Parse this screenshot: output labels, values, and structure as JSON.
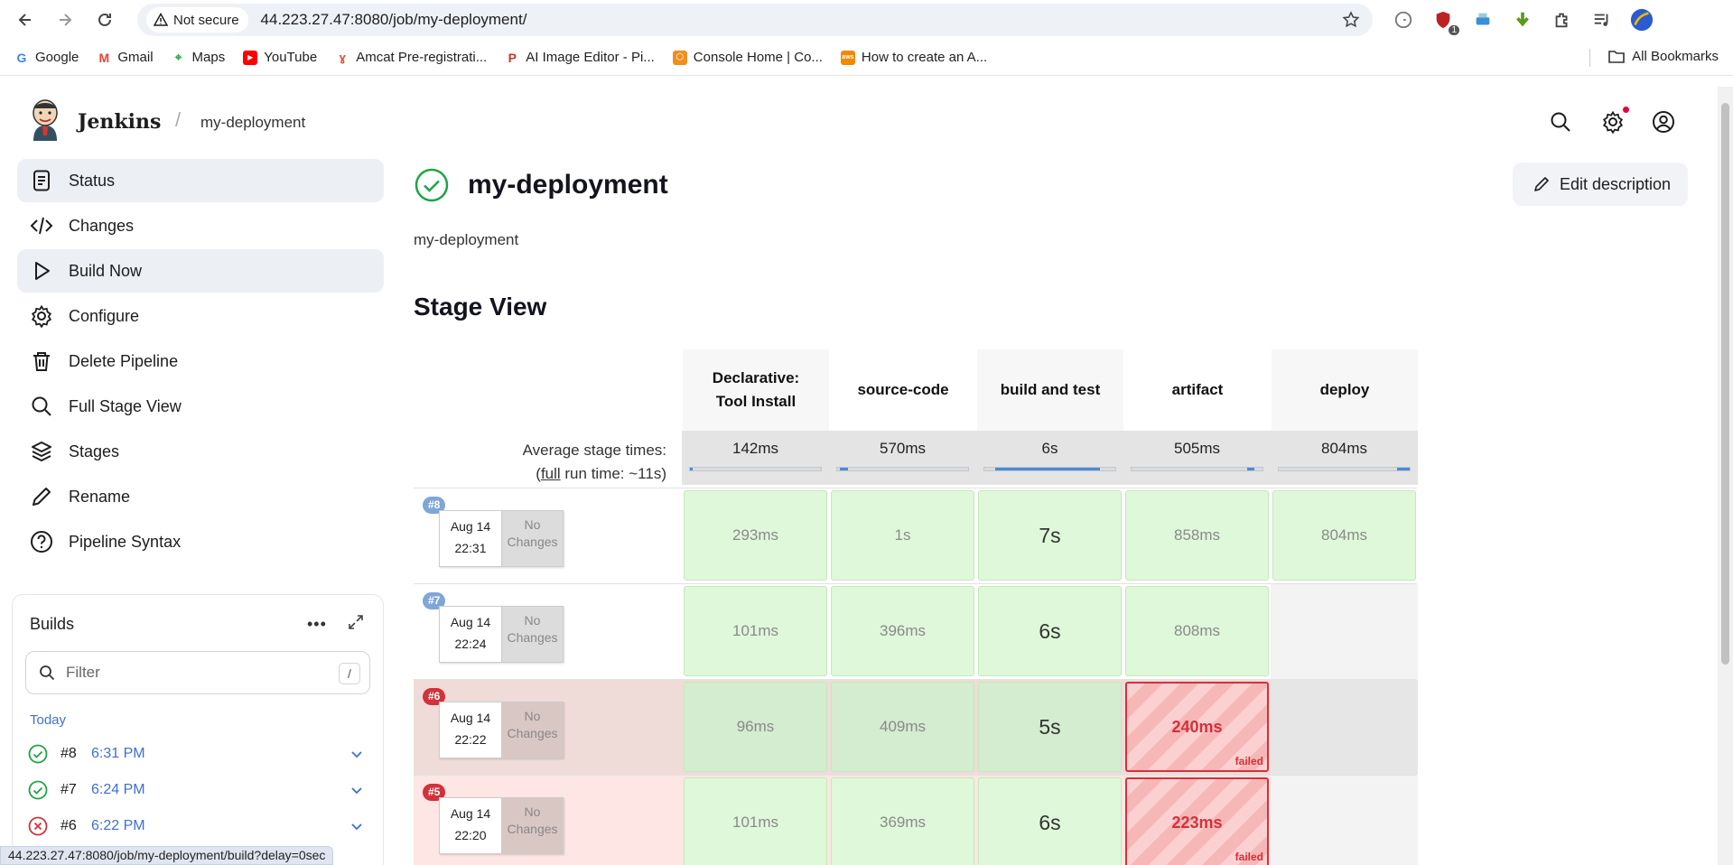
{
  "browser": {
    "security_label": "Not secure",
    "url": "44.223.27.47:8080/job/my-deployment/",
    "bookmarks": [
      {
        "label": "Google",
        "color": "#4285f4",
        "glyph": "G"
      },
      {
        "label": "Gmail",
        "color": "#ea4335",
        "glyph": "M"
      },
      {
        "label": "Maps",
        "color": "#34a853",
        "glyph": "⌖"
      },
      {
        "label": "YouTube",
        "color": "#ff0000",
        "glyph": "▶"
      },
      {
        "label": "Amcat Pre-registrati...",
        "color": "#e24a2a",
        "glyph": "A"
      },
      {
        "label": "AI Image Editor - Pi...",
        "color": "#c0392b",
        "glyph": "P"
      },
      {
        "label": "Console Home | Co...",
        "color": "#ef8f1f",
        "glyph": "⬡"
      },
      {
        "label": "How to create an A...",
        "color": "#f08a00",
        "glyph": "aws"
      }
    ],
    "all_bookmarks": "All Bookmarks",
    "status_url": "44.223.27.47:8080/job/my-deployment/build?delay=0sec",
    "extension_badge": "1"
  },
  "header": {
    "brand": "Jenkins",
    "breadcrumb": "my-deployment"
  },
  "sidebar": {
    "items": [
      {
        "label": "Status",
        "icon": "status-icon"
      },
      {
        "label": "Changes",
        "icon": "code-icon"
      },
      {
        "label": "Build Now",
        "icon": "play-icon"
      },
      {
        "label": "Configure",
        "icon": "gear-icon"
      },
      {
        "label": "Delete Pipeline",
        "icon": "trash-icon"
      },
      {
        "label": "Full Stage View",
        "icon": "search-icon"
      },
      {
        "label": "Stages",
        "icon": "layers-icon"
      },
      {
        "label": "Rename",
        "icon": "pencil-icon"
      },
      {
        "label": "Pipeline Syntax",
        "icon": "help-icon"
      }
    ]
  },
  "builds": {
    "title": "Builds",
    "filter_placeholder": "Filter",
    "filter_shortcut": "/",
    "group_label": "Today",
    "items": [
      {
        "number": "#8",
        "time": "6:31 PM",
        "status": "success"
      },
      {
        "number": "#7",
        "time": "6:24 PM",
        "status": "success"
      },
      {
        "number": "#6",
        "time": "6:22 PM",
        "status": "failed"
      }
    ]
  },
  "main": {
    "title": "my-deployment",
    "description": "my-deployment",
    "edit_description": "Edit description",
    "stage_view_title": "Stage View"
  },
  "stage_view": {
    "avg_label_line1": "Average stage times:",
    "avg_label_prefix": "(",
    "avg_label_full": "full",
    "avg_label_suffix": " run time: ~11s)",
    "stages": [
      {
        "name_line1": "Declarative:",
        "name_line2": "Tool Install",
        "avg": "142ms",
        "avg_fraction_start": 0.0,
        "avg_fraction_end": 0.02
      },
      {
        "name_line1": "source-code",
        "name_line2": "",
        "avg": "570ms",
        "avg_fraction_start": 0.02,
        "avg_fraction_end": 0.08
      },
      {
        "name_line1": "build and test",
        "name_line2": "",
        "avg": "6s",
        "avg_fraction_start": 0.08,
        "avg_fraction_end": 0.88
      },
      {
        "name_line1": "artifact",
        "name_line2": "",
        "avg": "505ms",
        "avg_fraction_start": 0.88,
        "avg_fraction_end": 0.94
      },
      {
        "name_line1": "deploy",
        "name_line2": "",
        "avg": "804ms",
        "avg_fraction_start": 0.9,
        "avg_fraction_end": 1.0
      }
    ],
    "runs": [
      {
        "badge": "#8",
        "date": "Aug 14",
        "time": "22:31",
        "changes_line1": "No",
        "changes_line2": "Changes",
        "result": "success",
        "cells": [
          "293ms",
          "1s",
          "7s",
          "858ms",
          "804ms"
        ],
        "cell_status": [
          "ok",
          "ok",
          "ok",
          "ok",
          "ok"
        ]
      },
      {
        "badge": "#7",
        "date": "Aug 14",
        "time": "22:24",
        "changes_line1": "No",
        "changes_line2": "Changes",
        "result": "success",
        "cells": [
          "101ms",
          "396ms",
          "6s",
          "808ms",
          ""
        ],
        "cell_status": [
          "ok",
          "ok",
          "ok",
          "ok",
          "empty"
        ]
      },
      {
        "badge": "#6",
        "date": "Aug 14",
        "time": "22:22",
        "changes_line1": "No",
        "changes_line2": "Changes",
        "result": "failed",
        "cells": [
          "96ms",
          "409ms",
          "5s",
          "240ms",
          ""
        ],
        "cell_status": [
          "ok",
          "ok",
          "ok",
          "fail",
          "empty"
        ]
      },
      {
        "badge": "#5",
        "date": "Aug 14",
        "time": "22:20",
        "changes_line1": "No",
        "changes_line2": "Changes",
        "result": "failed",
        "cells": [
          "101ms",
          "369ms",
          "6s",
          "223ms",
          ""
        ],
        "cell_status": [
          "ok",
          "ok",
          "ok",
          "fail",
          "empty"
        ]
      }
    ],
    "failed_label": "failed"
  },
  "colors": {
    "accent": "#3b6fd8",
    "success": "#1ea446",
    "failure": "#d3313b",
    "badge_success": "#7fa6d6",
    "badge_failed": "#d3313b"
  }
}
